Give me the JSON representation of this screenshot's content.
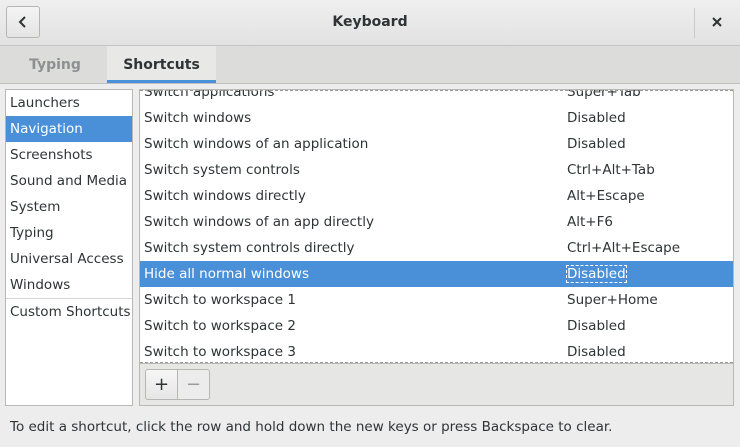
{
  "window": {
    "title": "Keyboard"
  },
  "icons": {
    "back": "chevron-left-icon",
    "close": "close-icon",
    "add": "plus-icon",
    "remove": "minus-icon"
  },
  "tabs": [
    {
      "label": "Typing",
      "active": false
    },
    {
      "label": "Shortcuts",
      "active": true
    }
  ],
  "sidebar": {
    "items": [
      {
        "label": "Launchers"
      },
      {
        "label": "Navigation",
        "selected": true
      },
      {
        "label": "Screenshots"
      },
      {
        "label": "Sound and Media"
      },
      {
        "label": "System"
      },
      {
        "label": "Typing"
      },
      {
        "label": "Universal Access"
      },
      {
        "label": "Windows"
      },
      {
        "label": "Custom Shortcuts"
      }
    ]
  },
  "shortcuts": [
    {
      "name": "Switch applications",
      "accel": "Super+Tab"
    },
    {
      "name": "Switch windows",
      "accel": "Disabled"
    },
    {
      "name": "Switch windows of an application",
      "accel": "Disabled"
    },
    {
      "name": "Switch system controls",
      "accel": "Ctrl+Alt+Tab"
    },
    {
      "name": "Switch windows directly",
      "accel": "Alt+Escape"
    },
    {
      "name": "Switch windows of an app directly",
      "accel": "Alt+F6"
    },
    {
      "name": "Switch system controls directly",
      "accel": "Ctrl+Alt+Escape"
    },
    {
      "name": "Hide all normal windows",
      "accel": "Disabled",
      "selected": true
    },
    {
      "name": "Switch to workspace 1",
      "accel": "Super+Home"
    },
    {
      "name": "Switch to workspace 2",
      "accel": "Disabled"
    },
    {
      "name": "Switch to workspace 3",
      "accel": "Disabled"
    }
  ],
  "toolbar": {
    "add_label": "+",
    "remove_label": "−"
  },
  "hint": "To edit a shortcut, click the row and hold down the new keys or press Backspace to clear.",
  "colors": {
    "accent": "#4a90d9"
  }
}
